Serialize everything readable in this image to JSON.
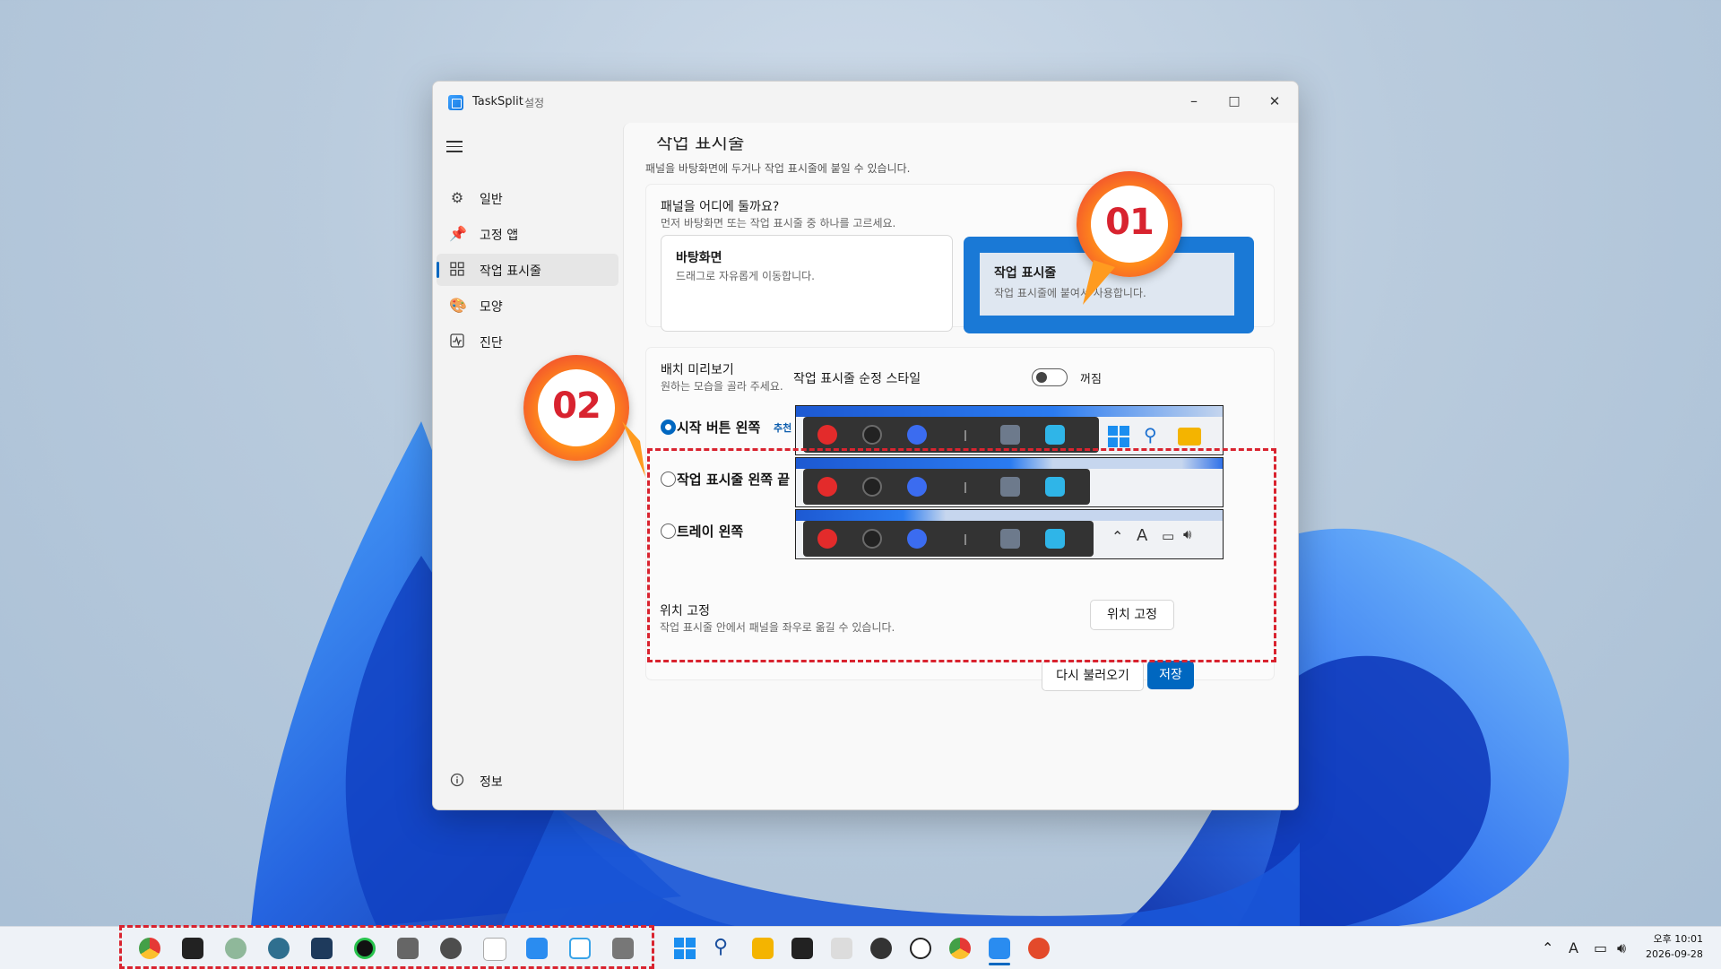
{
  "window": {
    "title": "TaskSplit",
    "subtitle": "설정",
    "minimize": "–",
    "maximize": "□",
    "close": "✕"
  },
  "sidebar": {
    "items": [
      {
        "label": "일반",
        "icon": "gear-icon"
      },
      {
        "label": "고정 앱",
        "icon": "pin-icon"
      },
      {
        "label": "작업 표시줄",
        "icon": "grid-icon",
        "active": true
      },
      {
        "label": "모양",
        "icon": "palette-icon"
      },
      {
        "label": "진단",
        "icon": "pulse-icon"
      }
    ],
    "footer": {
      "label": "정보",
      "icon": "info-icon"
    }
  },
  "main": {
    "section_title": "작업 표시줄",
    "section_desc": "패널을 바탕화면에 두거나 작업 표시줄에 붙일 수 있습니다.",
    "placement": {
      "title": "패널을 어디에 둘까요?",
      "desc": "먼저 바탕화면 또는 작업 표시줄 중 하나를 고르세요.",
      "options": [
        {
          "title": "바탕화면",
          "desc": "드래그로 자유롭게 이동합니다.",
          "selected": false
        },
        {
          "title": "작업 표시줄",
          "desc": "작업 표시줄에 붙여서 사용합니다.",
          "selected": true
        }
      ]
    },
    "layout": {
      "title": "배치 미리보기",
      "desc": "원하는 모습을 골라 주세요.",
      "style_label": "작업 표시줄 순정 스타일",
      "toggle_state": "꺼짐",
      "toggle_on": false,
      "options": [
        {
          "label": "시작 버튼 왼쪽",
          "badge": "추천",
          "selected": true
        },
        {
          "label": "작업 표시줄 왼쪽 끝",
          "badge": "",
          "selected": false
        },
        {
          "label": "트레이 왼쪽",
          "badge": "",
          "selected": false
        }
      ]
    },
    "lock": {
      "title": "위치 고정",
      "desc": "작업 표시줄 안에서 패널을 좌우로 옮길 수 있습니다.",
      "button": "위치 고정"
    },
    "buttons": {
      "reload": "다시 불러오기",
      "save": "저장"
    }
  },
  "callouts": {
    "first": "01",
    "second": "02"
  },
  "taskbar": {
    "clock_time": "오후 10:01",
    "clock_date": "2026-09-28",
    "tray_ime": "A",
    "accent": "#0067c0"
  }
}
